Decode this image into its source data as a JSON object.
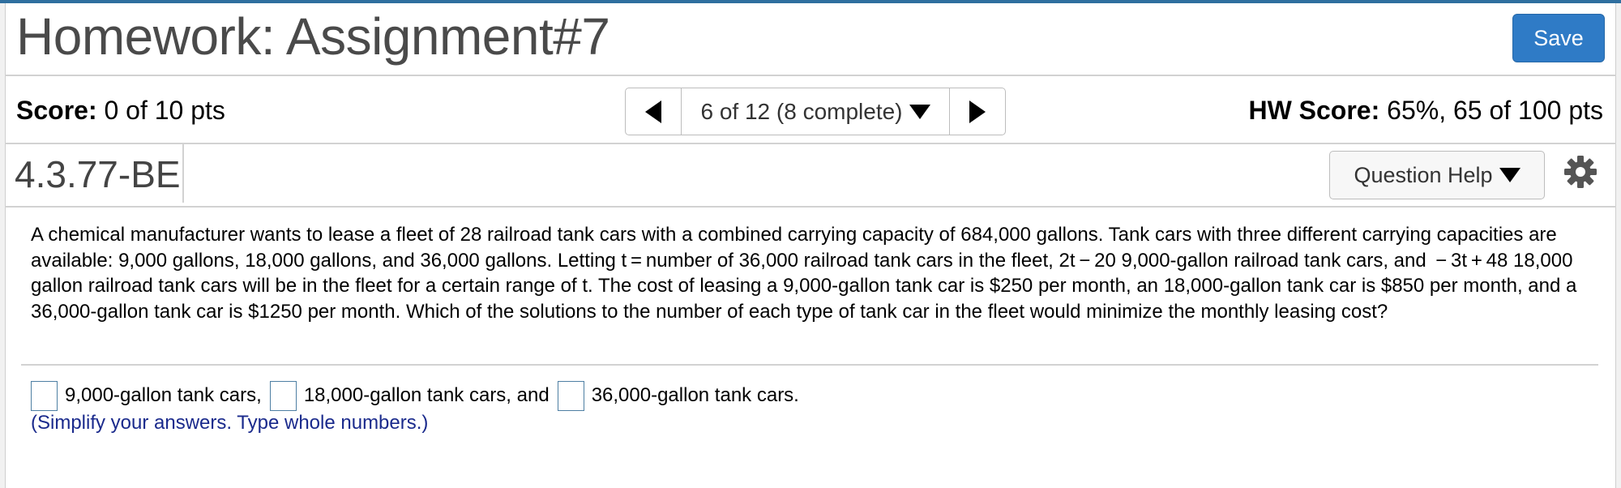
{
  "header": {
    "title": "Homework: Assignment#7",
    "save_label": "Save"
  },
  "score_bar": {
    "score_label": "Score:",
    "score_value": " 0 of 10 pts",
    "nav_position": "6 of 12 (8 complete)",
    "hw_score_label": "HW Score:",
    "hw_score_value": " 65%, 65 of 100 pts"
  },
  "question_bar": {
    "id": "4.3.77-BE",
    "help_label": "Question Help"
  },
  "question": {
    "text": "A chemical manufacturer wants to lease a fleet of 28 railroad tank cars with a combined carrying capacity of 684,000 gallons. Tank cars with three different carrying capacities are available: 9,000 gallons, 18,000 gallons, and 36,000 gallons. Letting t = number of 36,000 railroad tank cars in the fleet, 2t − 20 9,000-gallon railroad tank cars, and  − 3t + 48 18,000 gallon railroad tank cars will be in the fleet for a certain range of t. The cost of leasing a 9,000-gallon tank car is $250 per month, an 18,000-gallon tank car is $850 per month, and a 36,000-gallon tank car is $1250 per month. Which of the solutions to the number of each type of tank car in the fleet would minimize the monthly leasing cost?"
  },
  "answer": {
    "label1": "9,000-gallon tank cars,",
    "label2": "18,000-gallon tank cars, and",
    "label3": "36,000-gallon tank cars.",
    "input1_value": "",
    "input2_value": "",
    "input3_value": "",
    "note": "(Simplify your answers. Type whole numbers.)"
  },
  "colors": {
    "accent_top": "#2f6f9f",
    "save_button": "#2f7bc6",
    "note_text": "#1a2a8c",
    "input_border": "#4e7fa3"
  },
  "icons": [
    "caret-left-icon",
    "caret-right-icon",
    "caret-down-icon",
    "gear-icon"
  ]
}
